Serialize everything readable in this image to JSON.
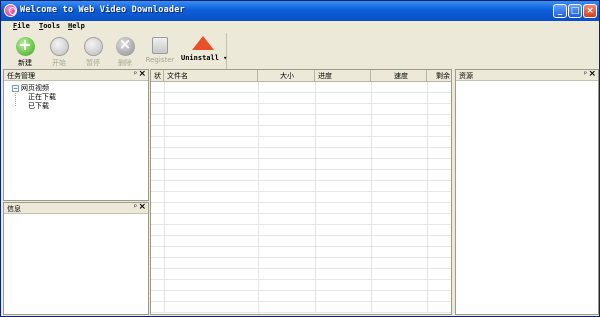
{
  "window": {
    "title": "Welcome to Web Video Downloader"
  },
  "titlebar_buttons": {
    "min": "_",
    "max": "□",
    "close": "×"
  },
  "menu": {
    "file": "File",
    "tools": "Tools",
    "help": "Help"
  },
  "toolbar": {
    "new": "新建",
    "start": "开始",
    "pause": "暂停",
    "delete": "删除",
    "register": "Register",
    "uninstall": "Uninstall ▾"
  },
  "task_panel": {
    "title": "任务管理",
    "pin": "ᵖ",
    "close": "×",
    "tree": {
      "root": "网页视频",
      "root_toggle": "−",
      "children": [
        "正在下载",
        "已下载"
      ]
    }
  },
  "info_panel": {
    "title": "信息",
    "pin": "ᵖ",
    "close": "×"
  },
  "grid": {
    "columns": [
      "状",
      "文件名",
      "大小",
      "进度",
      "速度",
      "剩余"
    ]
  },
  "resource_panel": {
    "title": "资源",
    "pin": "ᵖ",
    "close": "×"
  }
}
